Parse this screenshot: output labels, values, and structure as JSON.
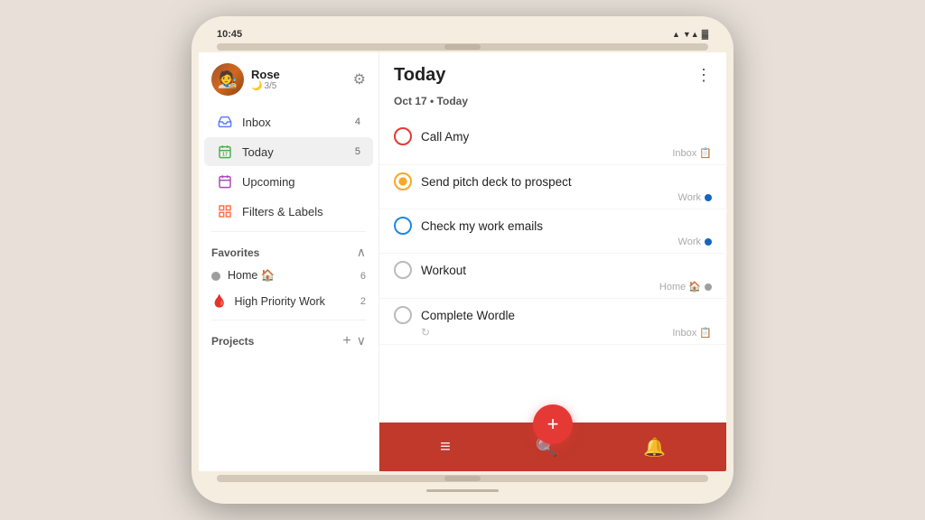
{
  "device": {
    "time": "10:45",
    "signal": "▲",
    "wifi": "▼▲",
    "battery": "▓"
  },
  "left_panel": {
    "user": {
      "name": "Rose",
      "karma": "3/5",
      "avatar_emoji": "🧑‍🎨"
    },
    "nav_items": [
      {
        "id": "inbox",
        "label": "Inbox",
        "badge": "4",
        "icon": "inbox"
      },
      {
        "id": "today",
        "label": "Today",
        "badge": "5",
        "icon": "today",
        "active": true
      },
      {
        "id": "upcoming",
        "label": "Upcoming",
        "badge": "",
        "icon": "upcoming"
      },
      {
        "id": "filters",
        "label": "Filters & Labels",
        "badge": "",
        "icon": "filter"
      }
    ],
    "favorites_title": "Favorites",
    "favorites": [
      {
        "id": "home",
        "label": "Home 🏠",
        "badge": "6",
        "color": "#9e9e9e"
      },
      {
        "id": "high-priority",
        "label": "High Priority Work",
        "badge": "2",
        "color": "#e53935"
      }
    ],
    "projects_title": "Projects"
  },
  "right_panel": {
    "title": "Today",
    "date_label": "Oct 17 • Today",
    "tasks": [
      {
        "id": "call-amy",
        "text": "Call Amy",
        "circle_color": "red",
        "tag": "Inbox",
        "tag_icon": "📋",
        "dot_color": null
      },
      {
        "id": "pitch-deck",
        "text": "Send pitch deck to prospect",
        "circle_color": "yellow-filled",
        "tag": "Work",
        "dot_color": "#1565c0"
      },
      {
        "id": "work-emails",
        "text": "Check my work emails",
        "circle_color": "blue",
        "tag": "Work",
        "dot_color": "#1565c0"
      },
      {
        "id": "workout",
        "text": "Workout",
        "circle_color": "gray",
        "tag": "Home",
        "tag_icon": "🏠",
        "dot_color": "#9e9e9e"
      },
      {
        "id": "wordle",
        "text": "Complete Wordle",
        "circle_color": "gray",
        "tag": "Inbox",
        "tag_icon": "📋",
        "repeat": true
      }
    ]
  },
  "bottom_bar": {
    "fab_label": "+",
    "menu_icon": "≡",
    "search_icon": "🔍",
    "bell_icon": "🔔"
  }
}
